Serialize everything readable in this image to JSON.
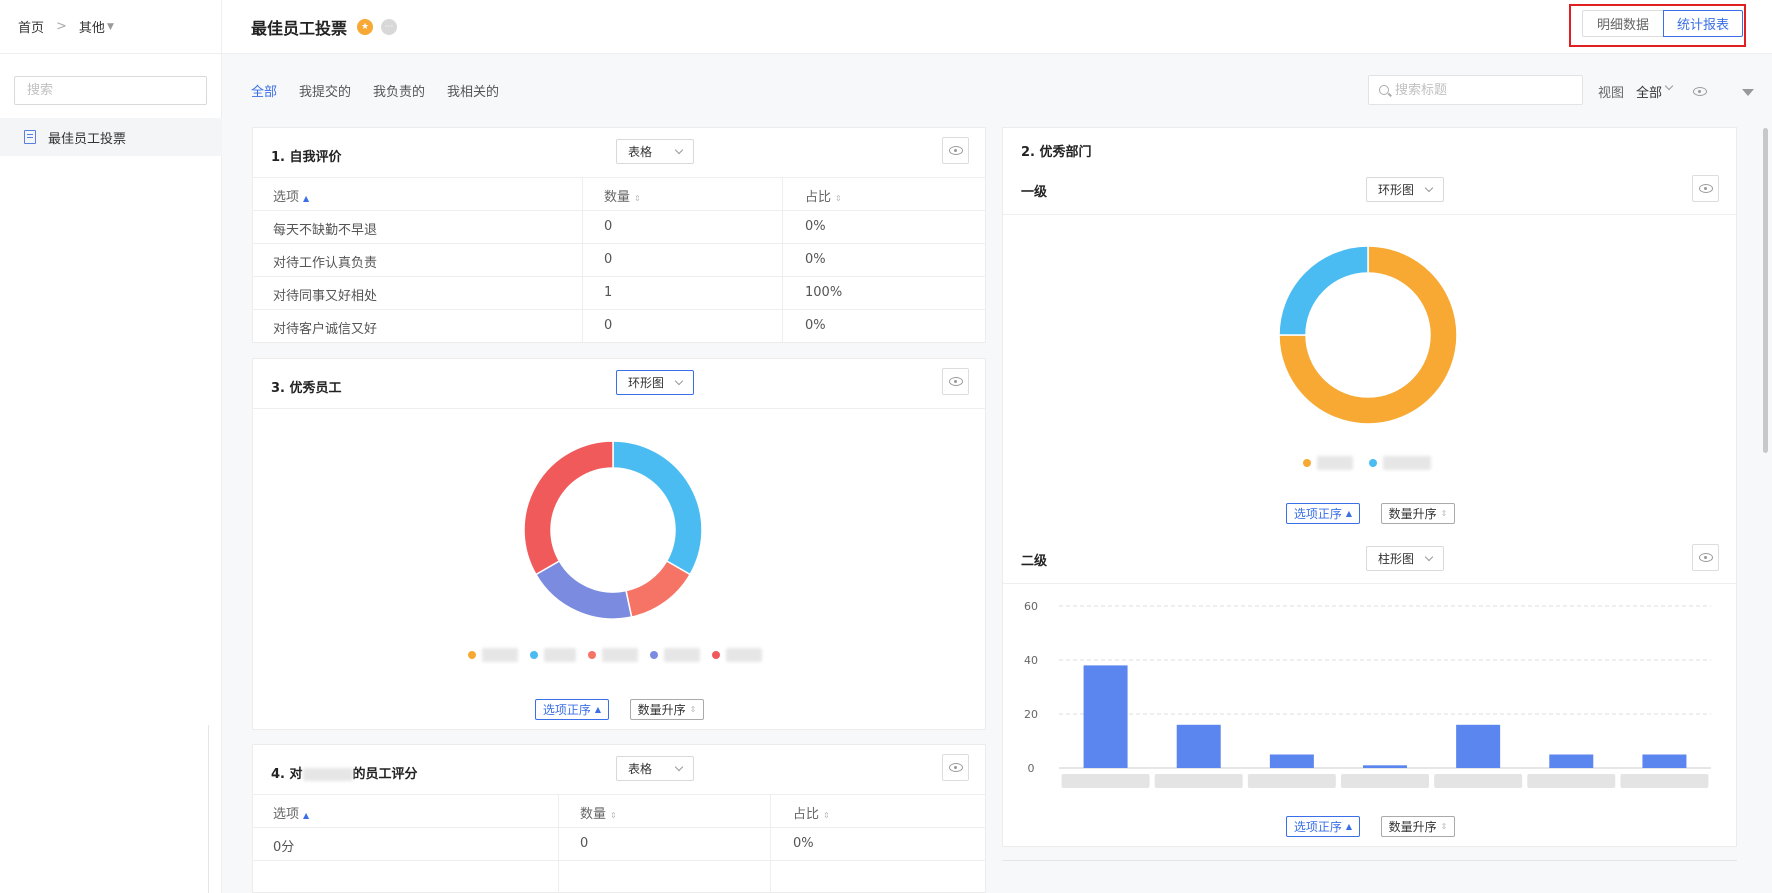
{
  "breadcrumb": {
    "home": "首页",
    "current": "其他"
  },
  "header": {
    "title": "最佳员工投票",
    "star_icon": "star-badge-icon",
    "more_icon": "more-icon"
  },
  "view_switch": {
    "detail": "明细数据",
    "report": "统计报表",
    "active": "统计报表"
  },
  "sidebar": {
    "search_placeholder": "搜索",
    "items": [
      {
        "label": "最佳员工投票",
        "icon": "document-icon",
        "active": true
      }
    ]
  },
  "filter_tabs": [
    "全部",
    "我提交的",
    "我负责的",
    "我相关的"
  ],
  "toolbar": {
    "search_placeholder": "搜索标题",
    "view_label": "视图",
    "view_value": "全部"
  },
  "colors": {
    "accent": "#3a6fe8",
    "orange": "#f7a933",
    "blue": "#4bbcf2",
    "red": "#f05a5a",
    "purple": "#7b8ce0",
    "salmon": "#f67466",
    "bar": "#5b86ef"
  },
  "q1": {
    "title": "1. 自我评价",
    "type": "表格",
    "headers": [
      "选项",
      "数量",
      "占比"
    ],
    "rows": [
      [
        "每天不缺勤不早退",
        "0",
        "0%"
      ],
      [
        "对待工作认真负责",
        "0",
        "0%"
      ],
      [
        "对待同事又好相处",
        "1",
        "100%"
      ],
      [
        "对待客户诚信又好",
        "0",
        "0%"
      ]
    ]
  },
  "q3": {
    "title": "3. 优秀员工",
    "type": "环形图",
    "sort_option": "选项正序",
    "sort_count": "数量升序",
    "chart_data": {
      "type": "pie",
      "donut": true,
      "values": [
        0,
        33.3,
        13.3,
        20,
        33.3
      ],
      "colors": [
        "#f7a933",
        "#4bbcf2",
        "#f67466",
        "#7b8ce0",
        "#f05a5a"
      ]
    }
  },
  "q4": {
    "title_prefix": "4. 对",
    "title_suffix": "的员工评分",
    "type": "表格",
    "headers": [
      "选项",
      "数量",
      "占比"
    ],
    "rows": [
      [
        "0分",
        "0",
        "0%"
      ]
    ]
  },
  "q2": {
    "title": "2. 优秀部门",
    "level1": {
      "title": "一级",
      "type": "环形图",
      "sort_option": "选项正序",
      "sort_count": "数量升序",
      "chart_data": {
        "type": "pie",
        "donut": true,
        "values": [
          75,
          25
        ],
        "colors": [
          "#f7a933",
          "#4bbcf2"
        ]
      }
    },
    "level2": {
      "title": "二级",
      "type": "柱形图",
      "sort_option": "选项正序",
      "sort_count": "数量升序",
      "chart_data": {
        "type": "bar",
        "values": [
          38,
          16,
          5,
          1,
          16,
          5,
          5
        ],
        "ylim": [
          0,
          60
        ],
        "yticks": [
          "0",
          "20",
          "40",
          "60"
        ],
        "grid": true
      }
    }
  }
}
